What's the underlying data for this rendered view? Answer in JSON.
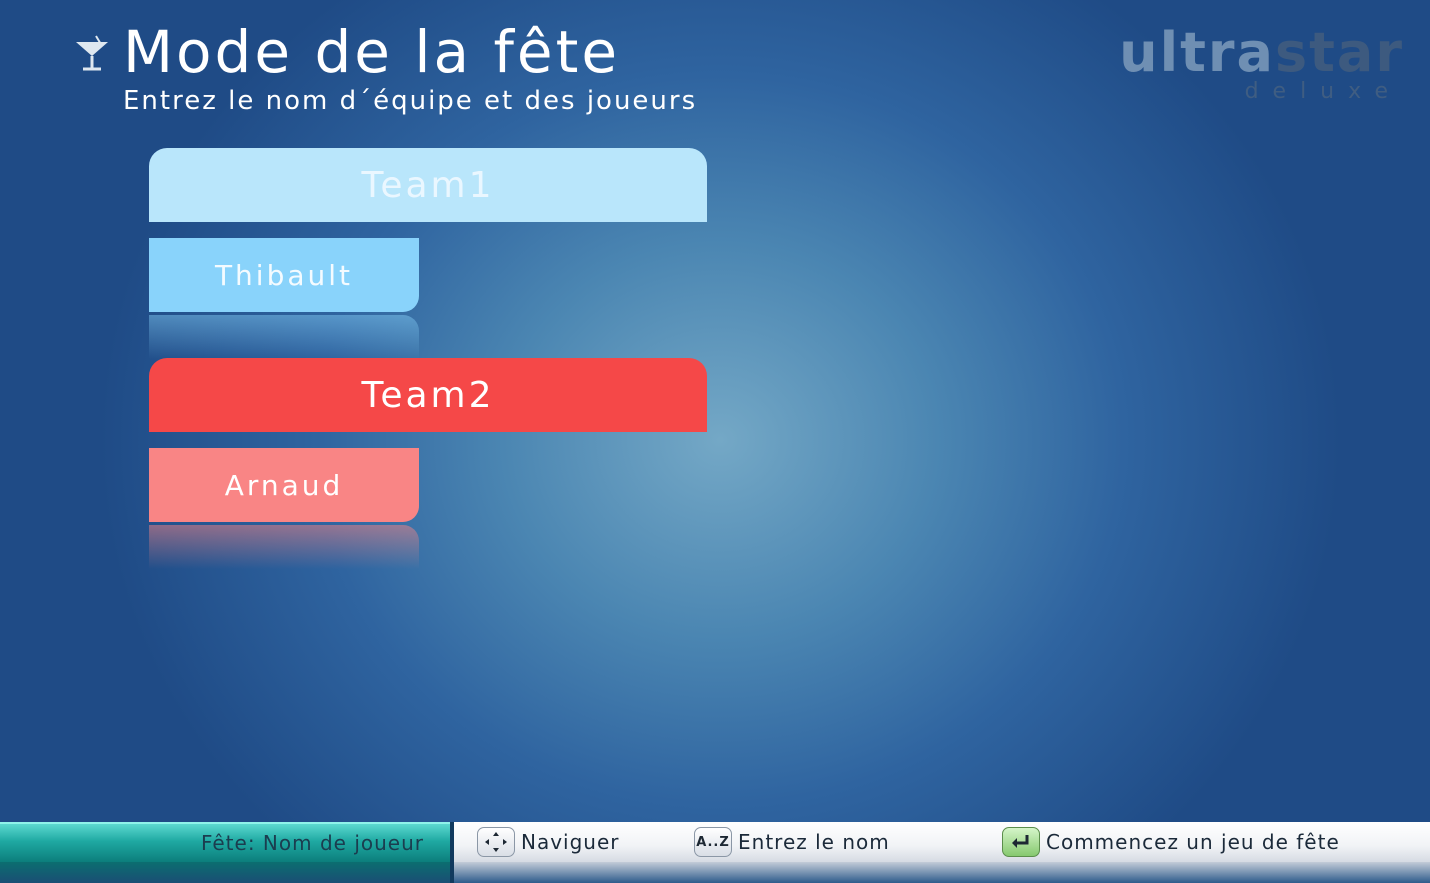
{
  "header": {
    "title": "Mode de la fête",
    "subtitle": "Entrez le nom d´équipe et des joueurs",
    "icon": "cocktail-glass-icon"
  },
  "logo": {
    "main_light": "ultra",
    "main_dark": "star",
    "sub": "deluxe"
  },
  "teams": [
    {
      "name": "Team1",
      "color": "#b9e6fb",
      "players": [
        {
          "name": "Thibault",
          "color": "#89d3fb"
        }
      ]
    },
    {
      "name": "Team2",
      "color": "#f54848",
      "players": [
        {
          "name": "Arnaud",
          "color": "#f98585"
        }
      ]
    }
  ],
  "footer": {
    "status": "Fête: Nom de joueur",
    "controls": [
      {
        "icon": "arrow-keys-icon",
        "key_label": "",
        "label": "Naviguer"
      },
      {
        "icon": "az-key-icon",
        "key_label": "A..Z",
        "label": "Entrez le nom"
      },
      {
        "icon": "enter-key-icon",
        "key_label": "",
        "label": "Commencez un jeu de fête"
      }
    ]
  }
}
